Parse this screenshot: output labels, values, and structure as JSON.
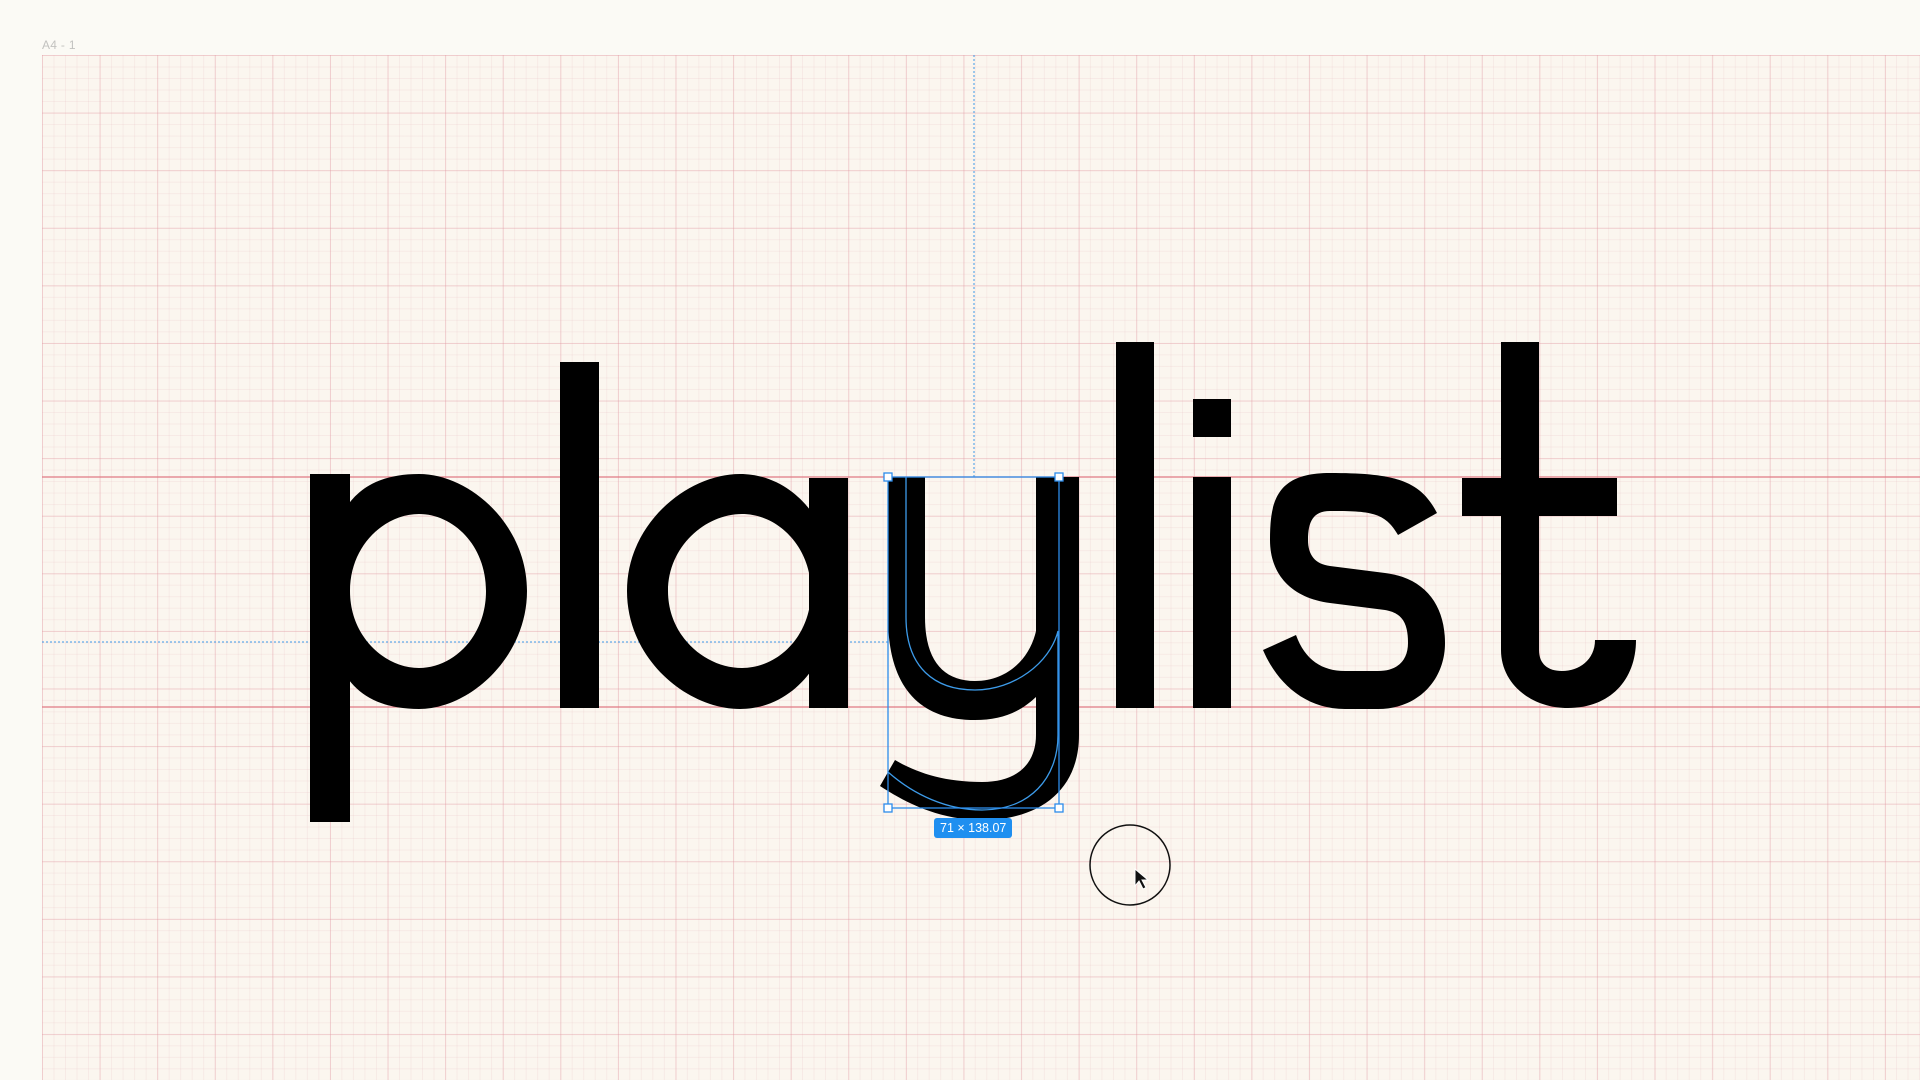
{
  "canvas": {
    "frame_label": "A4 - 1",
    "word": "playlist",
    "selected_glyph": "y",
    "selection_size_label": "71 × 138.07"
  },
  "colors": {
    "background": "#fbfaf5",
    "frame": "#fbf6ef",
    "grid": "#e296a0",
    "guide_red": "#e07a84",
    "guide_blue": "#3d9be9",
    "selection": "#2d8ceb",
    "glyph": "#000000"
  },
  "icons": {
    "cursor": "arrow-pointer-icon",
    "cursor_ring": "click-indicator-icon"
  }
}
